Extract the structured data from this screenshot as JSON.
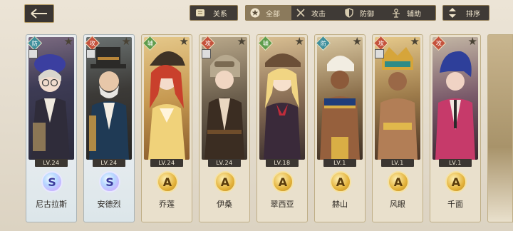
{
  "header": {
    "relation_label": "关系",
    "filters": [
      {
        "label": "全部",
        "icon": "star-icon",
        "active": true
      },
      {
        "label": "攻击",
        "icon": "crossed-swords-icon",
        "active": false
      },
      {
        "label": "防御",
        "icon": "shield-icon",
        "active": false
      },
      {
        "label": "辅助",
        "icon": "support-icon",
        "active": false
      }
    ],
    "sort_label": "排序"
  },
  "characters": [
    {
      "name": "尼古拉斯",
      "role": "防",
      "level": "LV.24",
      "rank": "S"
    },
    {
      "name": "安德烈",
      "role": "攻",
      "level": "LV.24",
      "rank": "S"
    },
    {
      "name": "乔莲",
      "role": "辅",
      "level": "LV.24",
      "rank": "A"
    },
    {
      "name": "伊桑",
      "role": "攻",
      "level": "LV.24",
      "rank": "A"
    },
    {
      "name": "翠西亚",
      "role": "辅",
      "level": "LV.18",
      "rank": "A"
    },
    {
      "name": "赫山",
      "role": "防",
      "level": "LV.1",
      "rank": "A"
    },
    {
      "name": "风眼",
      "role": "攻",
      "level": "LV.1",
      "rank": "A"
    },
    {
      "name": "千面",
      "role": "攻",
      "level": "LV.1",
      "rank": "A"
    }
  ],
  "colors": {
    "role_defense": "#3f8f9c",
    "role_attack": "#c5523c",
    "role_support": "#5e9c4c",
    "bar_dark": "#3f3a36",
    "accent_gold": "#b59b63"
  }
}
